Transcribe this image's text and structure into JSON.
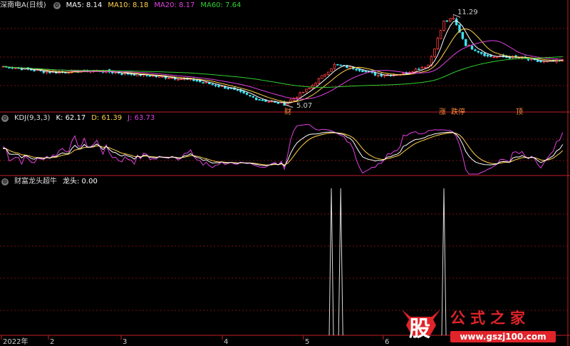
{
  "panel1": {
    "title": "深南电A(日线)",
    "ma": [
      {
        "label": "MA5: 8.14",
        "color": "#ffffff"
      },
      {
        "label": "MA10: 8.18",
        "color": "#ffd24a"
      },
      {
        "label": "MA20: 8.17",
        "color": "#e040e0"
      },
      {
        "label": "MA60: 7.64",
        "color": "#30d030"
      }
    ],
    "high_label": "11.29",
    "low_label": "5.07",
    "events": [
      "涨",
      "跌停",
      "跌",
      "顶"
    ],
    "low_event": "财"
  },
  "panel2": {
    "title": "KDJ(9,3,3)",
    "items": [
      {
        "label": "K: 62.17",
        "color": "#ffffff"
      },
      {
        "label": "D: 61.39",
        "color": "#ffd24a"
      },
      {
        "label": "J: 63.73",
        "color": "#e040e0"
      }
    ]
  },
  "panel3": {
    "title": "财富龙头超牛",
    "items": [
      {
        "label": "龙头: 0.00",
        "color": "#ffffff"
      }
    ]
  },
  "x_axis": {
    "labels": [
      "2022年",
      "2",
      "3",
      "4",
      "5",
      "6"
    ]
  },
  "watermark": {
    "logo_char": "股",
    "site_name": "公式之家",
    "url": "www.gszj100.com"
  },
  "colors": {
    "up": "#ff4040",
    "down": "#40e0f0",
    "divider": "#c0202a",
    "grid": "#7a1010"
  },
  "chart_data": {
    "type": "line",
    "price_range": [
      4.6,
      11.6
    ],
    "anchor_points": [
      {
        "bar": 0,
        "close": 7.7
      },
      {
        "bar": 15,
        "close": 7.3
      },
      {
        "bar": 30,
        "close": 7.4
      },
      {
        "bar": 45,
        "close": 7.1
      },
      {
        "bar": 60,
        "close": 6.8
      },
      {
        "bar": 72,
        "close": 6.2
      },
      {
        "bar": 82,
        "close": 5.4
      },
      {
        "bar": 90,
        "close": 5.1
      },
      {
        "bar": 98,
        "close": 6.2
      },
      {
        "bar": 106,
        "close": 7.8
      },
      {
        "bar": 112,
        "close": 7.6
      },
      {
        "bar": 120,
        "close": 7.1
      },
      {
        "bar": 128,
        "close": 7.2
      },
      {
        "bar": 136,
        "close": 7.8
      },
      {
        "bar": 141,
        "close": 10.8
      },
      {
        "bar": 144,
        "close": 11.0
      },
      {
        "bar": 148,
        "close": 9.2
      },
      {
        "bar": 155,
        "close": 8.4
      },
      {
        "bar": 165,
        "close": 8.3
      },
      {
        "bar": 172,
        "close": 8.0
      },
      {
        "bar": 179,
        "close": 8.1
      }
    ],
    "bar_count": 180,
    "low_point": {
      "bar": 90,
      "value": 5.07
    },
    "high_point": {
      "bar": 144,
      "value": 11.29
    },
    "longtou_signals": [
      {
        "bar": 105,
        "value": 1
      },
      {
        "bar": 108,
        "value": 1
      },
      {
        "bar": 141,
        "value": 1
      }
    ],
    "kdj_last": {
      "K": 62.17,
      "D": 61.39,
      "J": 63.73
    },
    "ma_last": {
      "MA5": 8.14,
      "MA10": 8.18,
      "MA20": 8.17,
      "MA60": 7.64
    }
  }
}
